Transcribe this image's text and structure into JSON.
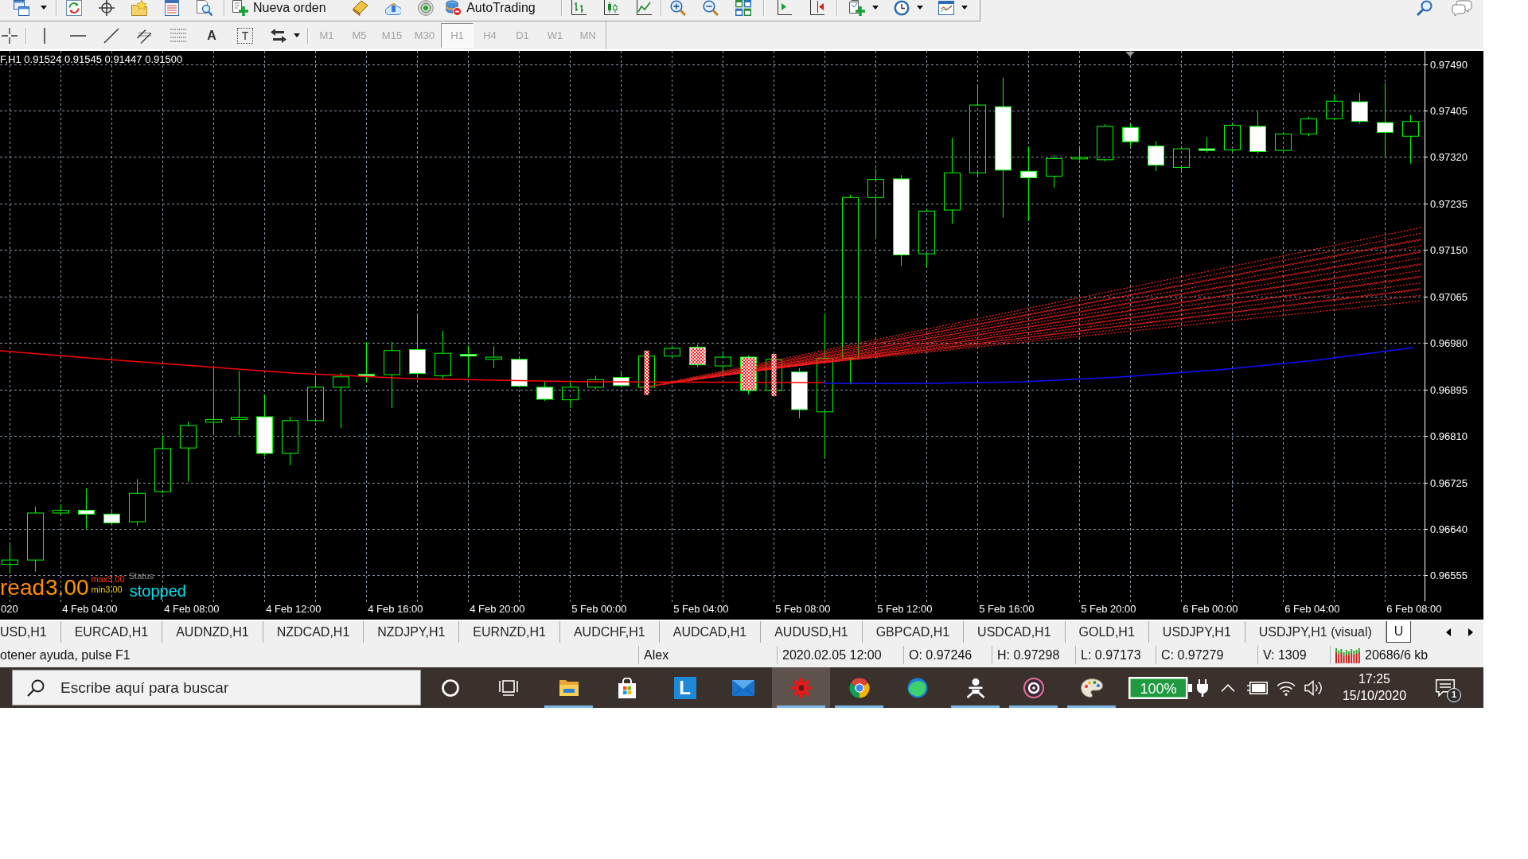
{
  "main_toolbar": {
    "new_order": "Nueva orden",
    "autotrading": {
      "label": "AutoTrading",
      "on": false
    }
  },
  "drawing_toolbar": {
    "text_tool": "A",
    "text_label_tool": "T",
    "timeframes": [
      {
        "label": "M1",
        "selected": false
      },
      {
        "label": "M5",
        "selected": false
      },
      {
        "label": "M15",
        "selected": false
      },
      {
        "label": "M30",
        "selected": false
      },
      {
        "label": "H1",
        "selected": true
      },
      {
        "label": "H4",
        "selected": false
      },
      {
        "label": "D1",
        "selected": false
      },
      {
        "label": "W1",
        "selected": false
      },
      {
        "label": "MN",
        "selected": false
      }
    ]
  },
  "chart": {
    "header": "F,H1 0.91524 0.91545 0.91447 0.91500",
    "price_labels": [
      "0.97490",
      "0.97405",
      "0.97320",
      "0.97235",
      "0.97150",
      "0.97065",
      "0.96980",
      "0.96895",
      "0.96810",
      "0.96725",
      "0.96640",
      "0.96555"
    ],
    "time_labels": [
      "020",
      "4 Feb 04:00",
      "4 Feb 08:00",
      "4 Feb 12:00",
      "4 Feb 16:00",
      "4 Feb 20:00",
      "5 Feb 00:00",
      "5 Feb 04:00",
      "5 Feb 08:00",
      "5 Feb 12:00",
      "5 Feb 16:00",
      "5 Feb 20:00",
      "6 Feb 00:00",
      "6 Feb 04:00",
      "6 Feb 08:00"
    ],
    "spread": {
      "label": "read",
      "value": "3.00",
      "max": "max3.00",
      "min": "min3.00"
    },
    "expert_status": {
      "label": "Status",
      "value": "stopped"
    }
  },
  "chart_tabs": [
    {
      "label": "USD,H1",
      "selected": false
    },
    {
      "label": "EURCAD,H1",
      "selected": false
    },
    {
      "label": "AUDNZD,H1",
      "selected": false
    },
    {
      "label": "NZDCAD,H1",
      "selected": false
    },
    {
      "label": "NZDJPY,H1",
      "selected": false
    },
    {
      "label": "EURNZD,H1",
      "selected": false
    },
    {
      "label": "AUDCHF,H1",
      "selected": false
    },
    {
      "label": "AUDCAD,H1",
      "selected": false
    },
    {
      "label": "AUDUSD,H1",
      "selected": false
    },
    {
      "label": "GBPCAD,H1",
      "selected": false
    },
    {
      "label": "USDCAD,H1",
      "selected": false
    },
    {
      "label": "GOLD,H1",
      "selected": false
    },
    {
      "label": "USDJPY,H1",
      "selected": false
    },
    {
      "label": "USDJPY,H1 (visual)",
      "selected": false
    },
    {
      "label": "U",
      "selected": true
    }
  ],
  "status_bar": {
    "cells": [
      "otener ayuda, pulse F1",
      "Alex",
      "2020.02.05 12:00",
      "O: 0.97246",
      "H: 0.97298",
      "L: 0.97173",
      "C: 0.97279",
      "V: 1309"
    ],
    "traffic": "20686/6 kb"
  },
  "taskbar": {
    "search": {
      "placeholder": "Escribe aquí para buscar"
    },
    "apps": [
      {
        "running": true,
        "selected": false
      },
      {
        "running": false,
        "selected": false
      },
      {
        "label": "L",
        "running": false,
        "selected": false
      },
      {
        "running": false,
        "selected": false
      },
      {
        "running": true,
        "selected": true
      },
      {
        "running": true,
        "selected": false
      },
      {
        "running": false,
        "selected": false
      },
      {
        "running": true,
        "selected": false
      },
      {
        "running": true,
        "selected": false
      },
      {
        "running": true,
        "selected": false
      }
    ],
    "battery": "100%",
    "clock": {
      "time": "17:25",
      "date": "15/10/2020"
    },
    "notifications": "1"
  }
}
